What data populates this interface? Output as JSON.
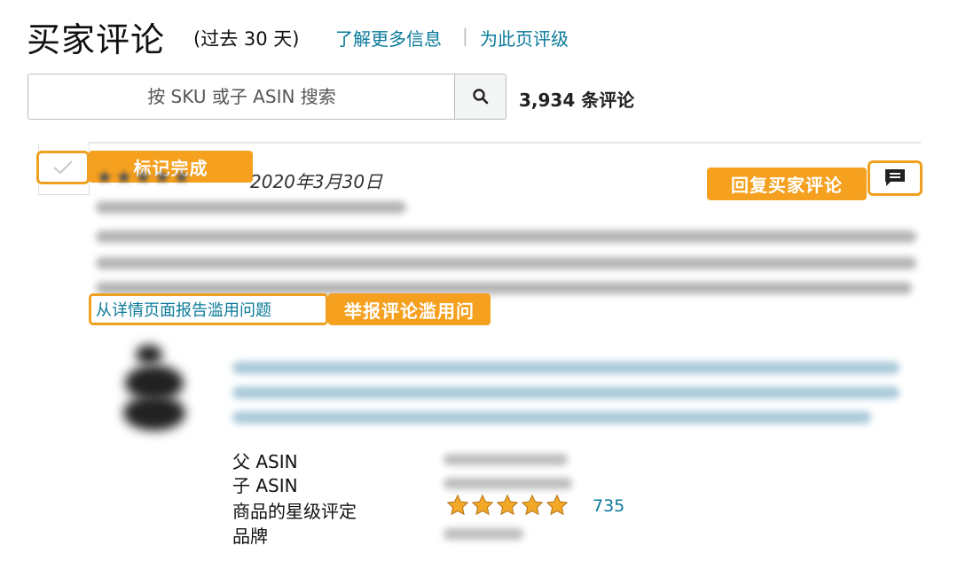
{
  "header": {
    "title": "买家评论",
    "period": "(过去 30 天)",
    "learn_more": "了解更多信息",
    "separator": "|",
    "rate_page": "为此页评级"
  },
  "search": {
    "placeholder": "按 SKU 或子 ASIN 搜索",
    "button_icon": "search-icon",
    "review_count": "3,934 条评论"
  },
  "review": {
    "date": "2020年3月30日",
    "report_link": "从详情页面报告滥用问题",
    "reply_icon": "comment-icon",
    "checkbox_icon": "check-icon"
  },
  "product": {
    "labels": [
      "父 ASIN",
      "子 ASIN",
      "商品的星级评定",
      "品牌"
    ],
    "rating": 5,
    "rating_count": "735"
  },
  "annotations": {
    "mark_done": "标记完成",
    "reply_review": "回复买家评论",
    "report_abuse": "举报评论滥用问"
  },
  "colors": {
    "accent": "#f5a01e",
    "link": "#0a7a9a",
    "star": "#f4a828"
  }
}
